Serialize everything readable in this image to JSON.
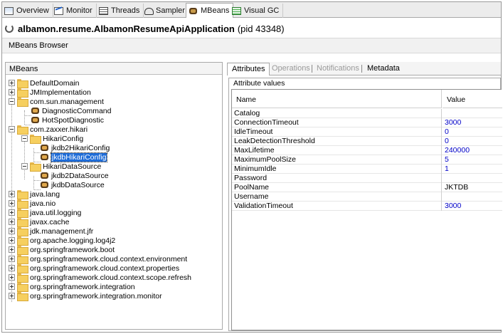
{
  "tabs": [
    {
      "label": "Overview",
      "icon": "overview-icon"
    },
    {
      "label": "Monitor",
      "icon": "monitor-icon"
    },
    {
      "label": "Threads",
      "icon": "threads-icon"
    },
    {
      "label": "Sampler",
      "icon": "sampler-icon"
    },
    {
      "label": "MBeans",
      "icon": "mbeans-icon",
      "active": true
    },
    {
      "label": "Visual GC",
      "icon": "visual-gc-icon"
    }
  ],
  "app": {
    "name": "albamon.resume.AlbamonResumeApiApplication",
    "pid": "(pid 43348)"
  },
  "subheader": "MBeans Browser",
  "left_panel": {
    "title": "MBeans"
  },
  "tree": {
    "default_domain": "DefaultDomain",
    "jmimplementation": "JMImplementation",
    "com_sun_management": "com.sun.management",
    "diagnostic_command": "DiagnosticCommand",
    "hotspot_diagnostic": "HotSpotDiagnostic",
    "com_zaxxer_hikari": "com.zaxxer.hikari",
    "hikari_config": "HikariConfig",
    "jkdb2_hikari_config": "jkdb2HikariConfig",
    "jkdb_hikari_config": "jkdbHikariConfig",
    "hikari_data_source": "HikariDataSource",
    "jkdb2_data_source": "jkdb2DataSource",
    "jkdb_data_source": "jkdbDataSource",
    "java_lang": "java.lang",
    "java_nio": "java.nio",
    "java_util_logging": "java.util.logging",
    "javax_cache": "javax.cache",
    "jdk_management_jfr": "jdk.management.jfr",
    "org_apache_logging_log4j2": "org.apache.logging.log4j2",
    "org_springframework_boot": "org.springframework.boot",
    "org_sf_cloud_env": "org.springframework.cloud.context.environment",
    "org_sf_cloud_props": "org.springframework.cloud.context.properties",
    "org_sf_cloud_scope": "org.springframework.cloud.context.scope.refresh",
    "org_sf_integration": "org.springframework.integration",
    "org_sf_integration_monitor": "org.springframework.integration.monitor"
  },
  "right_tabs": {
    "attributes": "Attributes",
    "operations": "Operations",
    "notifications": "Notifications",
    "metadata": "Metadata"
  },
  "attributes": {
    "section_label": "Attribute values",
    "col_name": "Name",
    "col_value": "Value",
    "rows": [
      {
        "name": "Catalog",
        "value": ""
      },
      {
        "name": "ConnectionTimeout",
        "value": "3000"
      },
      {
        "name": "IdleTimeout",
        "value": "0"
      },
      {
        "name": "LeakDetectionThreshold",
        "value": "0"
      },
      {
        "name": "MaxLifetime",
        "value": "240000"
      },
      {
        "name": "MaximumPoolSize",
        "value": "5"
      },
      {
        "name": "MinimumIdle",
        "value": "1"
      },
      {
        "name": "Password",
        "value": ""
      },
      {
        "name": "PoolName",
        "value": "JKTDB"
      },
      {
        "name": "Username",
        "value": ""
      },
      {
        "name": "ValidationTimeout",
        "value": "3000"
      }
    ]
  },
  "colors": {
    "accent": "#1e6cd8",
    "value_text": "#0000c8"
  }
}
